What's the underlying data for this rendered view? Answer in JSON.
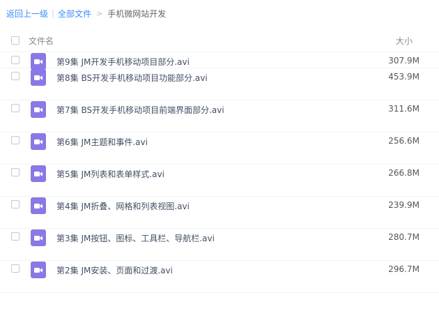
{
  "breadcrumb": {
    "back": "返回上一级",
    "separator": "|",
    "all_files": "全部文件",
    "arrow": ">",
    "current": "手机微网站开发"
  },
  "table_header": {
    "name": "文件名",
    "size": "大小"
  },
  "icon_color": "#8a78e6",
  "files": [
    {
      "name": "第9集 JM开发手机移动项目部分.avi",
      "size": "307.9M",
      "icon": "video-icon"
    },
    {
      "name": "第8集 BS开发手机移动项目功能部分.avi",
      "size": "453.9M",
      "icon": "video-icon"
    },
    {
      "name": "第7集 BS开发手机移动项目前端界面部分.avi",
      "size": "311.6M",
      "icon": "video-icon"
    },
    {
      "name": "第6集 JM主题和事件.avi",
      "size": "256.6M",
      "icon": "video-icon"
    },
    {
      "name": "第5集 JM列表和表单样式.avi",
      "size": "266.8M",
      "icon": "video-icon"
    },
    {
      "name": "第4集 JM折叠、网格和列表视图.avi",
      "size": "239.9M",
      "icon": "video-icon"
    },
    {
      "name": "第3集 JM按钮、图标、工具栏、导航栏.avi",
      "size": "280.7M",
      "icon": "video-icon"
    },
    {
      "name": "第2集 JM安装、页面和过渡.avi",
      "size": "296.7M",
      "icon": "video-icon"
    }
  ]
}
